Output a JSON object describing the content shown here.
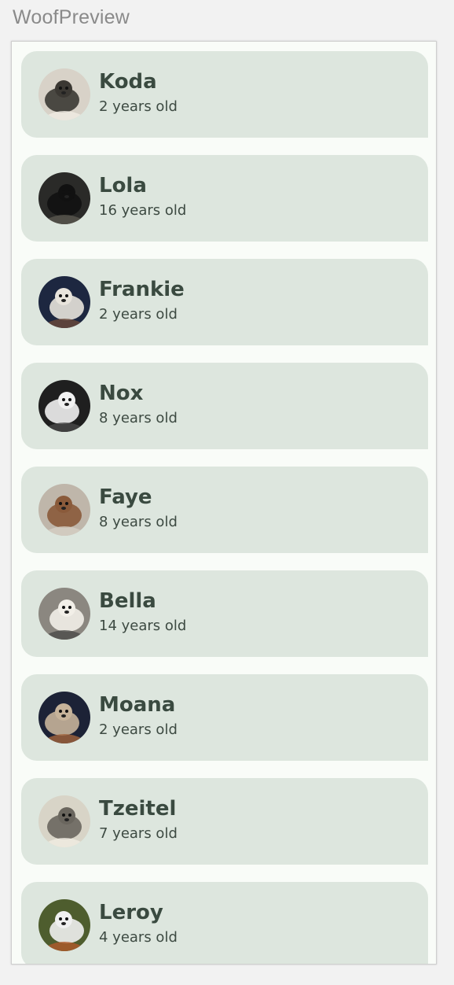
{
  "preview": {
    "title": "WoofPreview"
  },
  "dogs": [
    {
      "name": "Koda",
      "age": "2 years old",
      "photo": "husky-photo",
      "colors": [
        "#d8d2c8",
        "#3b3833",
        "#f1ece4"
      ]
    },
    {
      "name": "Lola",
      "age": "16 years old",
      "photo": "black-dog-photo",
      "colors": [
        "#2a2a28",
        "#111111",
        "#5a574f"
      ]
    },
    {
      "name": "Frankie",
      "age": "2 years old",
      "photo": "tricolor-dog-photo",
      "colors": [
        "#1d2740",
        "#e8e4dc",
        "#6b4a3a"
      ]
    },
    {
      "name": "Nox",
      "age": "8 years old",
      "photo": "black-fluffy-dog-photo",
      "colors": [
        "#1f1f1f",
        "#f0f0f0",
        "#494949"
      ]
    },
    {
      "name": "Faye",
      "age": "8 years old",
      "photo": "small-dog-floor-photo",
      "colors": [
        "#bfb6aa",
        "#8a5a3a",
        "#d6cfc4"
      ]
    },
    {
      "name": "Bella",
      "age": "14 years old",
      "photo": "white-dog-gravel-photo",
      "colors": [
        "#8b8780",
        "#f2efe8",
        "#4b4b48"
      ]
    },
    {
      "name": "Moana",
      "age": "2 years old",
      "photo": "corgi-blanket-photo",
      "colors": [
        "#1c2236",
        "#c6b39a",
        "#a3643c"
      ]
    },
    {
      "name": "Tzeitel",
      "age": "7 years old",
      "photo": "pug-sleeping-photo",
      "colors": [
        "#d8d4c7",
        "#6a665e",
        "#f1ece2"
      ]
    },
    {
      "name": "Leroy",
      "age": "4 years old",
      "photo": "corgi-grass-photo",
      "colors": [
        "#4e5d2e",
        "#f0f0f0",
        "#b05a2a"
      ]
    }
  ]
}
